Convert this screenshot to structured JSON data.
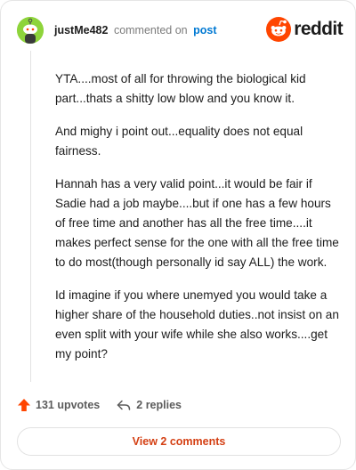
{
  "comment": {
    "username": "justMe482",
    "action_text": "commented on",
    "post_link": "post",
    "avatar_icon": "snoo-avatar-icon",
    "paragraphs": [
      "YTA....most of all for throwing the biological kid part...thats a shitty low blow and you know it.",
      "And mighy i point out...equality does not equal fairness.",
      "Hannah has a very valid point...it would be fair if Sadie had a job maybe....but if one has a few hours of free time and another has all the free time....it makes perfect sense for the one with all the free time to do most(though personally id say ALL) the work.",
      "Id imagine if you where unemyed you would take a higher share of the household duties..not insist on an even split with your wife while she also works....get my point?"
    ]
  },
  "brand": {
    "name": "reddit",
    "icon": "reddit-logo-icon",
    "color": "#ff4500"
  },
  "actions": {
    "upvotes": "131 upvotes",
    "replies": "2 replies",
    "upvote_icon": "upvote-arrow-icon",
    "reply_icon": "reply-arrow-icon",
    "upvote_color": "#ff4500"
  },
  "view_button": {
    "label": "View 2 comments",
    "color": "#d44014"
  }
}
